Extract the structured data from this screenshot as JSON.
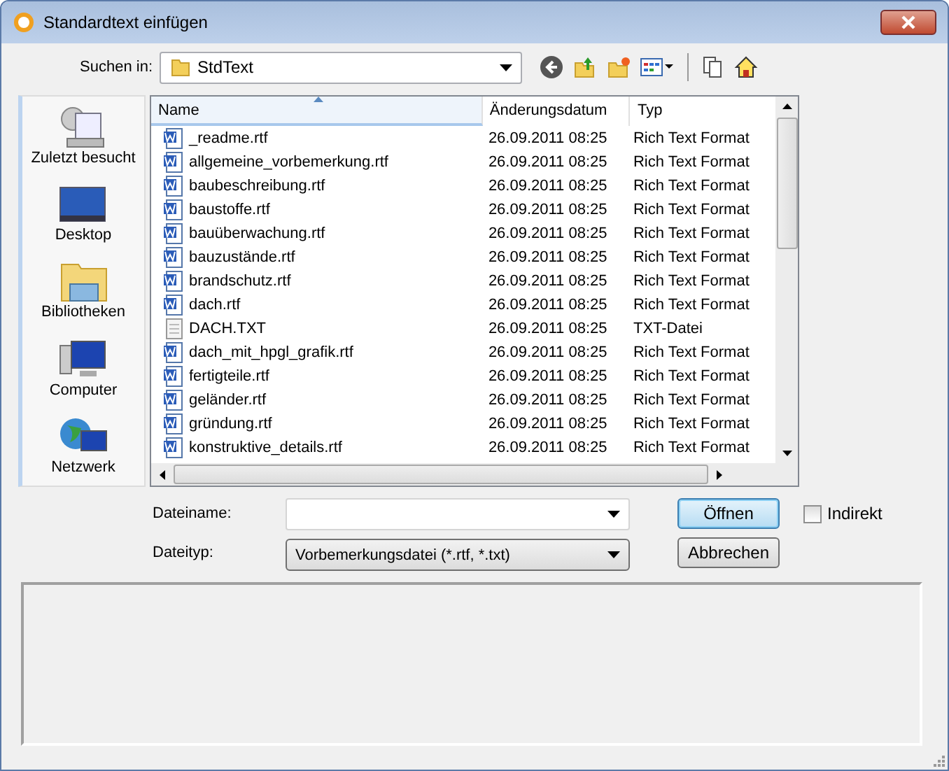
{
  "window": {
    "title": "Standardtext einfügen"
  },
  "location": {
    "label": "Suchen in:",
    "value": "StdText"
  },
  "sidebar": {
    "items": [
      {
        "label": "Zuletzt besucht",
        "kind": "recent"
      },
      {
        "label": "Desktop",
        "kind": "desktop"
      },
      {
        "label": "Bibliotheken",
        "kind": "libraries"
      },
      {
        "label": "Computer",
        "kind": "computer"
      },
      {
        "label": "Netzwerk",
        "kind": "network"
      }
    ]
  },
  "table": {
    "columns": [
      {
        "label": "Name",
        "sorted": true
      },
      {
        "label": "Änderungsdatum",
        "sorted": false
      },
      {
        "label": "Typ",
        "sorted": false
      }
    ],
    "rows": [
      {
        "name": "_readme.rtf",
        "date": "26.09.2011 08:25",
        "type": "Rich Text Format",
        "kind": "rtf"
      },
      {
        "name": "allgemeine_vorbemerkung.rtf",
        "date": "26.09.2011 08:25",
        "type": "Rich Text Format",
        "kind": "rtf"
      },
      {
        "name": "baubeschreibung.rtf",
        "date": "26.09.2011 08:25",
        "type": "Rich Text Format",
        "kind": "rtf"
      },
      {
        "name": "baustoffe.rtf",
        "date": "26.09.2011 08:25",
        "type": "Rich Text Format",
        "kind": "rtf"
      },
      {
        "name": "bauüberwachung.rtf",
        "date": "26.09.2011 08:25",
        "type": "Rich Text Format",
        "kind": "rtf"
      },
      {
        "name": "bauzustände.rtf",
        "date": "26.09.2011 08:25",
        "type": "Rich Text Format",
        "kind": "rtf"
      },
      {
        "name": "brandschutz.rtf",
        "date": "26.09.2011 08:25",
        "type": "Rich Text Format",
        "kind": "rtf"
      },
      {
        "name": "dach.rtf",
        "date": "26.09.2011 08:25",
        "type": "Rich Text Format",
        "kind": "rtf"
      },
      {
        "name": "DACH.TXT",
        "date": "26.09.2011 08:25",
        "type": "TXT-Datei",
        "kind": "txt"
      },
      {
        "name": "dach_mit_hpgl_grafik.rtf",
        "date": "26.09.2011 08:25",
        "type": "Rich Text Format",
        "kind": "rtf"
      },
      {
        "name": "fertigteile.rtf",
        "date": "26.09.2011 08:25",
        "type": "Rich Text Format",
        "kind": "rtf"
      },
      {
        "name": "geländer.rtf",
        "date": "26.09.2011 08:25",
        "type": "Rich Text Format",
        "kind": "rtf"
      },
      {
        "name": "gründung.rtf",
        "date": "26.09.2011 08:25",
        "type": "Rich Text Format",
        "kind": "rtf"
      },
      {
        "name": "konstruktive_details.rtf",
        "date": "26.09.2011 08:25",
        "type": "Rich Text Format",
        "kind": "rtf"
      }
    ]
  },
  "filename": {
    "label": "Dateiname:"
  },
  "filetype": {
    "label": "Dateityp:",
    "value": "Vorbemerkungsdatei (*.rtf, *.txt)"
  },
  "buttons": [
    {
      "label": "Öffnen",
      "default": true
    },
    {
      "label": "Abbrechen",
      "default": false
    }
  ],
  "indirect": {
    "label": "Indirekt",
    "checked": false
  }
}
